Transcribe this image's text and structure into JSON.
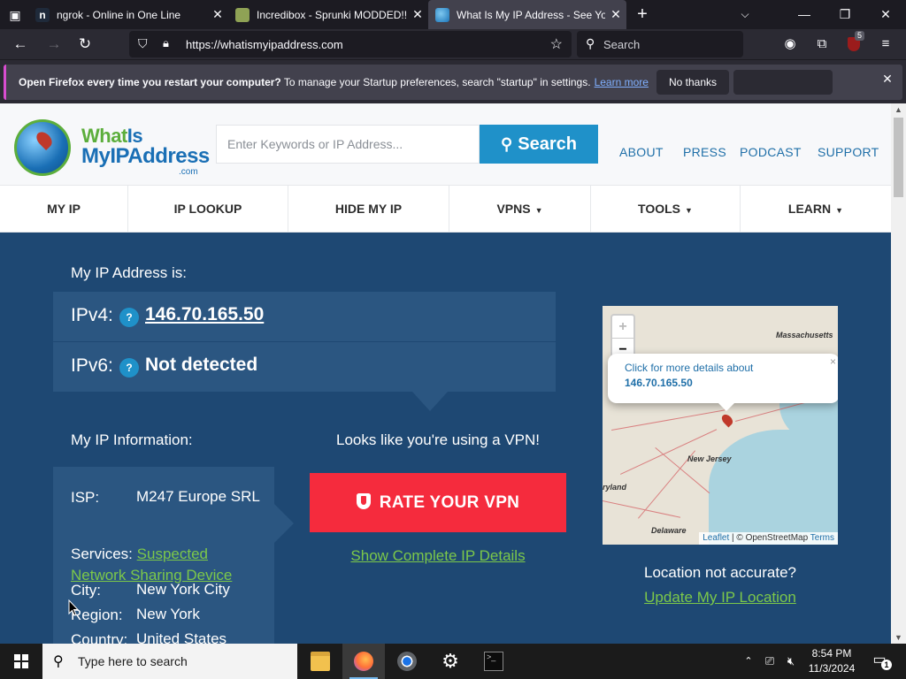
{
  "browser": {
    "tabs": [
      {
        "title": "ngrok - Online in One Line",
        "favicon": "ngrok-favicon"
      },
      {
        "title": "Incredibox - Sprunki MODDED!!",
        "favicon": "incredibox-favicon"
      },
      {
        "title": "What Is My IP Address - See Your",
        "favicon": "globe-favicon",
        "active": true
      }
    ],
    "url": "https://whatismyipaddress.com",
    "search_placeholder": "Search",
    "extension_badge": "5"
  },
  "notification": {
    "bold": "Open Firefox every time you restart your computer?",
    "text": " To manage your Startup preferences, search \"startup\" in settings.",
    "learn_more": "Learn more",
    "no_thanks": "No thanks"
  },
  "site": {
    "logo": {
      "part1": "What",
      "part2": "Is",
      "line2": "MyIPAddress",
      "tld": ".com"
    },
    "search_placeholder": "Enter Keywords or IP Address...",
    "search_button": "Search",
    "top_links": [
      "ABOUT",
      "PRESS",
      "PODCAST",
      "SUPPORT"
    ],
    "nav": [
      {
        "label": "MY IP",
        "dropdown": false
      },
      {
        "label": "IP LOOKUP",
        "dropdown": false
      },
      {
        "label": "HIDE MY IP",
        "dropdown": false
      },
      {
        "label": "VPNS",
        "dropdown": true
      },
      {
        "label": "TOOLS",
        "dropdown": true
      },
      {
        "label": "LEARN",
        "dropdown": true
      }
    ]
  },
  "ip": {
    "heading": "My IP Address is:",
    "ipv4_label": "IPv4:",
    "ipv4_value": "146.70.165.50",
    "ipv6_label": "IPv6:",
    "ipv6_value": "Not detected",
    "help": "?"
  },
  "info": {
    "heading": "My IP Information:",
    "isp_label": "ISP:",
    "isp_value": "M247 Europe SRL",
    "services_label": "Services:",
    "services_value": "Suspected Network Sharing Device",
    "city_label": "City:",
    "city_value": "New York City",
    "region_label": "Region:",
    "region_value": "New York",
    "country_label": "Country:",
    "country_value": "United States"
  },
  "vpn": {
    "message": "Looks like you're using a VPN!",
    "rate_button": "RATE YOUR VPN",
    "show_details": "Show Complete IP Details"
  },
  "map": {
    "zoom_in": "+",
    "zoom_out": "−",
    "popup_line1": "Click for more details about",
    "popup_ip": "146.70.165.50",
    "labels": [
      "Massachusetts",
      "New Jersey",
      "ryland",
      "Delaware"
    ],
    "attribution_leaflet": "Leaflet",
    "attribution_osm": " | © OpenStreetMap ",
    "attribution_terms": "Terms"
  },
  "location": {
    "question": "Location not accurate?",
    "update_link": "Update My IP Location"
  },
  "taskbar": {
    "search_placeholder": "Type here to search",
    "time": "8:54 PM",
    "date": "11/3/2024",
    "notification_count": "1"
  }
}
